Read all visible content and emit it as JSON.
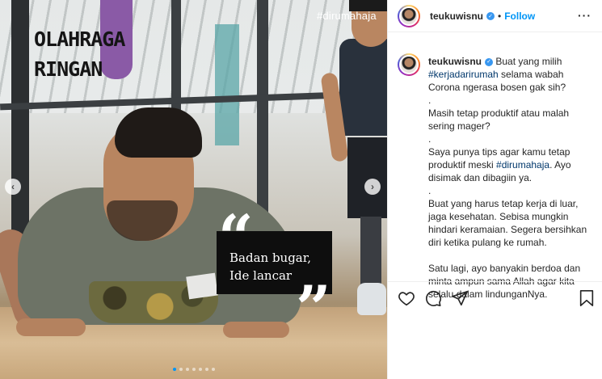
{
  "post": {
    "photo_overlay": {
      "title_line1": "OLAHRAGA",
      "title_line2": "RINGAN",
      "hashtag": "#dirumahaja",
      "quote_line1": "Badan bugar,",
      "quote_line2": "Ide lancar",
      "open_quote": "“",
      "close_quote": "”"
    },
    "carousel": {
      "prev": "‹",
      "next": "›",
      "total_slides": 7,
      "active_index": 0
    }
  },
  "header": {
    "username": "teukuwisnu",
    "separator": "•",
    "follow_label": "Follow",
    "more": "···",
    "verified_mark": "✓"
  },
  "caption": {
    "username": "teukuwisnu",
    "lines": [
      {
        "parts": [
          {
            "t": " Buat yang milih",
            "tag": false
          }
        ]
      },
      {
        "parts": [
          {
            "t": "#kerjadarirumah",
            "tag": true
          },
          {
            "t": " selama wabah",
            "tag": false
          }
        ]
      },
      {
        "parts": [
          {
            "t": "Corona ngerasa bosen gak sih?",
            "tag": false
          }
        ]
      },
      {
        "parts": [
          {
            "t": ".",
            "tag": false
          }
        ]
      },
      {
        "parts": [
          {
            "t": "Masih tetap produktif atau malah",
            "tag": false
          }
        ]
      },
      {
        "parts": [
          {
            "t": "sering mager?",
            "tag": false
          }
        ]
      },
      {
        "parts": [
          {
            "t": ".",
            "tag": false
          }
        ]
      },
      {
        "parts": [
          {
            "t": "Saya punya tips agar kamu tetap",
            "tag": false
          }
        ]
      },
      {
        "parts": [
          {
            "t": "produktif meski ",
            "tag": false
          },
          {
            "t": "#dirumahaja",
            "tag": true
          },
          {
            "t": ". Ayo",
            "tag": false
          }
        ]
      },
      {
        "parts": [
          {
            "t": "disimak dan dibagiin ya.",
            "tag": false
          }
        ]
      },
      {
        "parts": [
          {
            "t": ".",
            "tag": false
          }
        ]
      },
      {
        "parts": [
          {
            "t": "Buat yang harus tetap kerja di luar,",
            "tag": false
          }
        ]
      },
      {
        "parts": [
          {
            "t": "jaga kesehatan. Sebisa mungkin",
            "tag": false
          }
        ]
      },
      {
        "parts": [
          {
            "t": "hindari keramaian. Segera bersihkan",
            "tag": false
          }
        ]
      },
      {
        "parts": [
          {
            "t": "diri ketika pulang ke rumah.",
            "tag": false
          }
        ]
      },
      {
        "parts": [
          {
            "t": "",
            "tag": false
          }
        ]
      },
      {
        "parts": [
          {
            "t": "Satu lagi, ayo banyakin berdoa dan",
            "tag": false
          }
        ]
      },
      {
        "parts": [
          {
            "t": "minta ampun sama Allah agar kita",
            "tag": false
          }
        ]
      },
      {
        "parts": [
          {
            "t": "selalu dalam lindunganNya.",
            "tag": false
          }
        ]
      }
    ]
  },
  "actions": {
    "like_icon": "heart-icon",
    "comment_icon": "comment-icon",
    "share_icon": "share-icon",
    "save_icon": "bookmark-icon"
  },
  "colors": {
    "accent": "#0095f6",
    "hashtag": "#00376b",
    "verified": "#3897f0"
  }
}
